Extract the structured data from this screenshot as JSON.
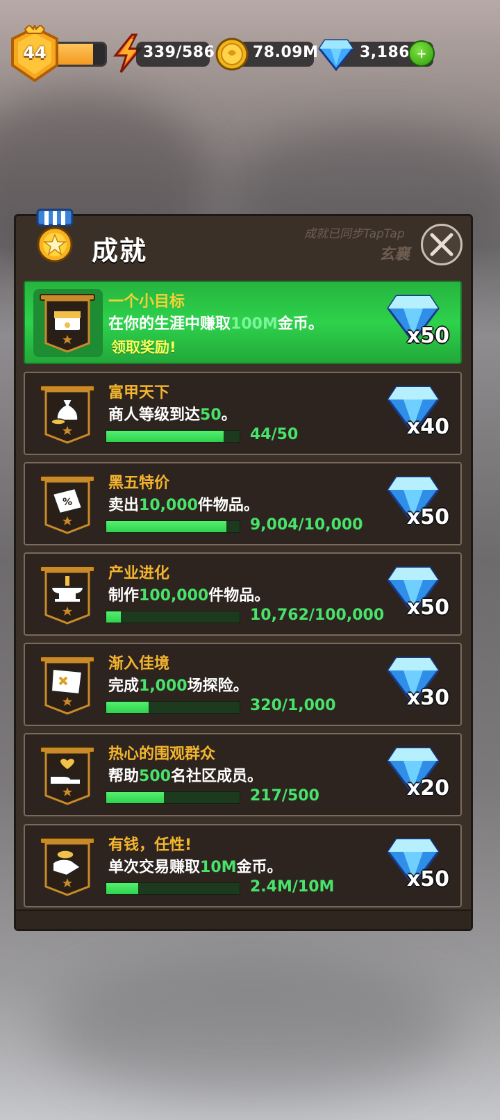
{
  "header": {
    "level": "44",
    "level_progress": 0.8,
    "energy": "339/586",
    "gold": "78.09M",
    "gems": "3,186",
    "add_gems_label": "+"
  },
  "panel": {
    "title": "成就",
    "sync_text": "成就已同步TapTap",
    "user_name": "玄襄"
  },
  "achievements": [
    {
      "title": "一个小目标",
      "desc_before": "在你的生涯中赚取",
      "desc_value": "100M",
      "desc_after": "金币。",
      "claim_label": "领取奖励!",
      "reward": "x50",
      "status": "completed",
      "icon": "treasure-chest-icon"
    },
    {
      "title": "富甲天下",
      "desc_before": "商人等级到达",
      "desc_value": "50",
      "desc_after": "。",
      "progress": "44/50",
      "fraction": 0.88,
      "reward": "x40",
      "icon": "money-bag-icon"
    },
    {
      "title": "黑五特价",
      "desc_before": "卖出",
      "desc_value": "10,000",
      "desc_after": "件物品。",
      "progress": "9,004/10,000",
      "fraction": 0.9,
      "reward": "x50",
      "icon": "discount-tag-icon"
    },
    {
      "title": "产业进化",
      "desc_before": "制作",
      "desc_value": "100,000",
      "desc_after": "件物品。",
      "progress": "10,762/100,000",
      "fraction": 0.11,
      "reward": "x50",
      "icon": "anvil-icon"
    },
    {
      "title": "渐入佳境",
      "desc_before": "完成",
      "desc_value": "1,000",
      "desc_after": "场探险。",
      "progress": "320/1,000",
      "fraction": 0.32,
      "reward": "x30",
      "icon": "treasure-map-icon"
    },
    {
      "title": "热心的围观群众",
      "desc_before": "帮助",
      "desc_value": "500",
      "desc_after": "名社区成员。",
      "progress": "217/500",
      "fraction": 0.434,
      "reward": "x20",
      "icon": "helping-hand-icon"
    },
    {
      "title": "有钱，任性!",
      "desc_before": "单次交易赚取",
      "desc_value": "10M",
      "desc_after": "金币。",
      "progress": "2.4M/10M",
      "fraction": 0.24,
      "reward": "x50",
      "icon": "coin-stack-icon"
    }
  ],
  "colors": {
    "accent_gold": "#f4b52e",
    "progress_green": "#47e36a",
    "completed_row": "#2ed24c",
    "panel_bg": "#3b3028"
  }
}
